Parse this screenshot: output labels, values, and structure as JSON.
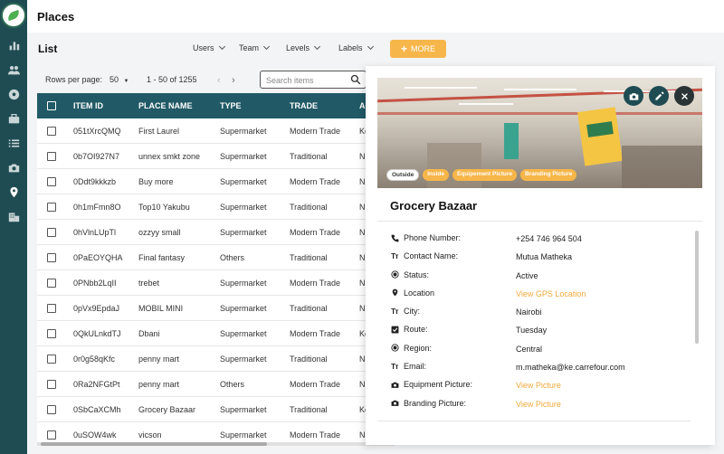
{
  "header": {
    "title": "Places"
  },
  "sidebar": {
    "items": [
      {
        "icon": "logo"
      },
      {
        "icon": "bar-chart-icon"
      },
      {
        "icon": "users-icon"
      },
      {
        "icon": "soccer-ball-icon"
      },
      {
        "icon": "briefcase-icon"
      },
      {
        "icon": "list-icon"
      },
      {
        "icon": "camera-icon"
      },
      {
        "icon": "location-pin-icon",
        "active": true
      },
      {
        "icon": "building-icon"
      }
    ]
  },
  "list": {
    "title": "List",
    "filters": [
      "Users",
      "Team",
      "Levels",
      "Labels"
    ],
    "more_label": "MORE",
    "rows_per_page_label": "Rows per page:",
    "rows_per_page_value": "50",
    "range_label": "1 - 50 of 1255",
    "search_placeholder": "Search items"
  },
  "table": {
    "columns": [
      "ITEM ID",
      "PLACE NAME",
      "TYPE",
      "TRADE",
      "AC"
    ],
    "rows": [
      {
        "id": "051tXrcQMQ",
        "name": "First Laurel",
        "type": "Supermarket",
        "trade": "Modern Trade",
        "ch": "Ke"
      },
      {
        "id": "0b7OI927N7",
        "name": "unnex smkt zone",
        "type": "Supermarket",
        "trade": "Traditional",
        "ch": "N"
      },
      {
        "id": "0Ddt9kkkzb",
        "name": "Buy more",
        "type": "Supermarket",
        "trade": "Modern Trade",
        "ch": "N"
      },
      {
        "id": "0h1mFmn8O",
        "name": "Top10 Yakubu",
        "type": "Supermarket",
        "trade": "Traditional",
        "ch": "N"
      },
      {
        "id": "0hVlnLUpTl",
        "name": "ozzyy small",
        "type": "Supermarket",
        "trade": "Modern Trade",
        "ch": "N"
      },
      {
        "id": "0PaEOYQHA",
        "name": "Final fantasy",
        "type": "Others",
        "trade": "Traditional",
        "ch": "N"
      },
      {
        "id": "0PNbb2LqII",
        "name": "trebet",
        "type": "Supermarket",
        "trade": "Modern Trade",
        "ch": "N"
      },
      {
        "id": "0pVx9EpdaJ",
        "name": "MOBIL MINI",
        "type": "Supermarket",
        "trade": "Traditional",
        "ch": "N"
      },
      {
        "id": "0QkULnkdTJ",
        "name": "Dbani",
        "type": "Supermarket",
        "trade": "Modern Trade",
        "ch": "Ke"
      },
      {
        "id": "0r0g58qKfc",
        "name": "penny mart",
        "type": "Supermarket",
        "trade": "Traditional",
        "ch": "N"
      },
      {
        "id": "0Ra2NFGtPt",
        "name": "penny mart",
        "type": "Others",
        "trade": "Modern Trade",
        "ch": "N"
      },
      {
        "id": "0SbCaXCMh",
        "name": "Grocery Bazaar",
        "type": "Supermarket",
        "trade": "Traditional",
        "ch": "Ke"
      },
      {
        "id": "0uSOW4wk",
        "name": "vicson",
        "type": "Supermarket",
        "trade": "Modern Trade",
        "ch": "N"
      }
    ]
  },
  "detail": {
    "title": "Grocery Bazaar",
    "photo_tabs": [
      "Outside",
      "Inside",
      "Equipement Picture",
      "Branding Picture"
    ],
    "active_photo_tab": "Outside",
    "fields": [
      {
        "icon": "phone-icon",
        "label": "Phone Number:",
        "value": "+254 746 964 504",
        "link": false
      },
      {
        "icon": "text-icon",
        "label": "Contact Name:",
        "value": "Mutua Matheka",
        "link": false
      },
      {
        "icon": "radio-icon",
        "label": "Status:",
        "value": "Active",
        "link": false
      },
      {
        "icon": "location-pin-icon",
        "label": "Location",
        "value": "View GPS Location",
        "link": true
      },
      {
        "icon": "text-icon",
        "label": "City:",
        "value": "Nairobi",
        "link": false
      },
      {
        "icon": "checkbox-icon",
        "label": "Route:",
        "value": "Tuesday",
        "link": false
      },
      {
        "icon": "radio-icon",
        "label": "Region:",
        "value": "Central",
        "link": false
      },
      {
        "icon": "text-icon",
        "label": "Email:",
        "value": "m.matheka@ke.carrefour.com",
        "link": false
      },
      {
        "icon": "camera-icon",
        "label": "Equipment Picture:",
        "value": "View Picture",
        "link": true
      },
      {
        "icon": "camera-icon",
        "label": "Branding Picture:",
        "value": "View Picture",
        "link": true
      }
    ]
  },
  "colors": {
    "sidebar": "#1f4c53",
    "table_header": "#215a66",
    "accent": "#f7b64a",
    "link": "#f2a93b"
  }
}
